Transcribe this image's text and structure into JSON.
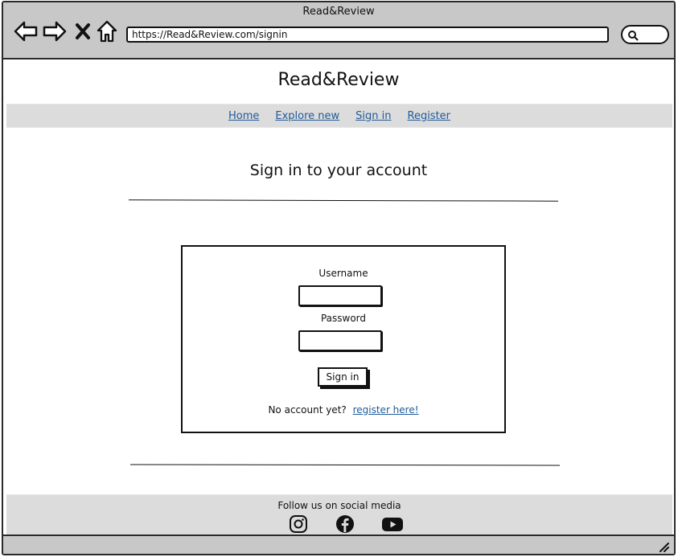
{
  "window": {
    "title": "Read&Review"
  },
  "browser": {
    "url": "https://Read&Review.com/signin",
    "icons": [
      "back-arrow-icon",
      "forward-arrow-icon",
      "close-x-icon",
      "home-icon",
      "search-icon"
    ]
  },
  "site": {
    "title": "Read&Review"
  },
  "nav": {
    "home": "Home",
    "explore": "Explore new",
    "signin": "Sign in",
    "register": "Register"
  },
  "page": {
    "heading": "Sign in to your account"
  },
  "form": {
    "username_label": "Username",
    "username_value": "",
    "password_label": "Password",
    "password_value": "",
    "submit_label": "Sign in",
    "no_account_text": "No account yet?",
    "register_link": "register here!"
  },
  "footer": {
    "text": "Follow us on social media",
    "icons": [
      "instagram-icon",
      "facebook-icon",
      "youtube-icon"
    ]
  },
  "colors": {
    "link": "#1f5b9a",
    "chrome": "#c8c8c8",
    "bar": "#dcdcdc",
    "ink": "#111111"
  }
}
